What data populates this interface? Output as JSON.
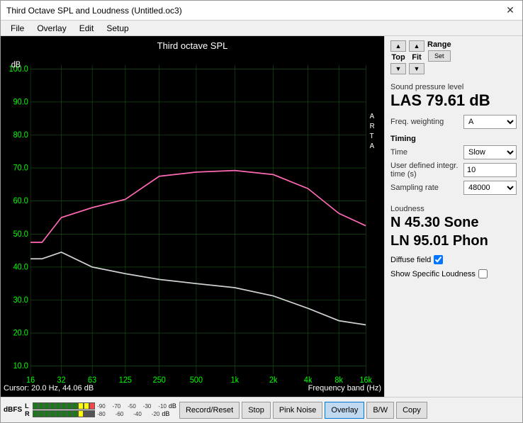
{
  "window": {
    "title": "Third Octave SPL and Loudness (Untitled.oc3)",
    "close_btn": "✕"
  },
  "menu": {
    "items": [
      "File",
      "Overlay",
      "Edit",
      "Setup"
    ]
  },
  "nav": {
    "top_label": "Top",
    "fit_label": "Fit",
    "range_label": "Range",
    "set_label": "Set"
  },
  "spl": {
    "section_label": "Sound pressure level",
    "value": "LAS 79.61 dB",
    "freq_weighting_label": "Freq. weighting",
    "freq_weighting_value": "A"
  },
  "timing": {
    "section_label": "Timing",
    "time_label": "Time",
    "time_value": "Slow",
    "user_defined_label": "User defined integr. time (s)",
    "user_defined_value": "10",
    "sampling_label": "Sampling rate",
    "sampling_value": "48000"
  },
  "loudness": {
    "section_label": "Loudness",
    "n_value": "N 45.30 Sone",
    "ln_value": "LN 95.01 Phon",
    "diffuse_field_label": "Diffuse field",
    "diffuse_field_checked": true,
    "show_specific_label": "Show Specific Loudness",
    "show_specific_checked": false
  },
  "chart": {
    "title": "Third octave SPL",
    "y_label": "dB",
    "arta_label": "A\nR\nT\nA",
    "y_max": "100.0",
    "y_marks": [
      "100.0",
      "90.0",
      "80.0",
      "70.0",
      "60.0",
      "50.0",
      "40.0",
      "30.0",
      "20.0",
      "10.0"
    ],
    "x_marks": [
      "16",
      "32",
      "63",
      "125",
      "250",
      "500",
      "1k",
      "2k",
      "4k",
      "8k",
      "16k"
    ],
    "cursor_text": "Cursor:  20.0 Hz, 44.06 dB",
    "freq_band_label": "Frequency band (Hz)"
  },
  "bottom": {
    "dBFS_label": "dBFS",
    "dB_label": "dB",
    "L_label": "L",
    "R_label": "R",
    "level_marks_L": [
      "-90",
      "-70",
      "-50",
      "-30",
      "-10"
    ],
    "level_marks_R": [
      "-80",
      "-60",
      "-40",
      "-20"
    ],
    "buttons": [
      "Record/Reset",
      "Stop",
      "Pink Noise",
      "Overlay",
      "B/W",
      "Copy"
    ],
    "active_button": "Overlay"
  }
}
